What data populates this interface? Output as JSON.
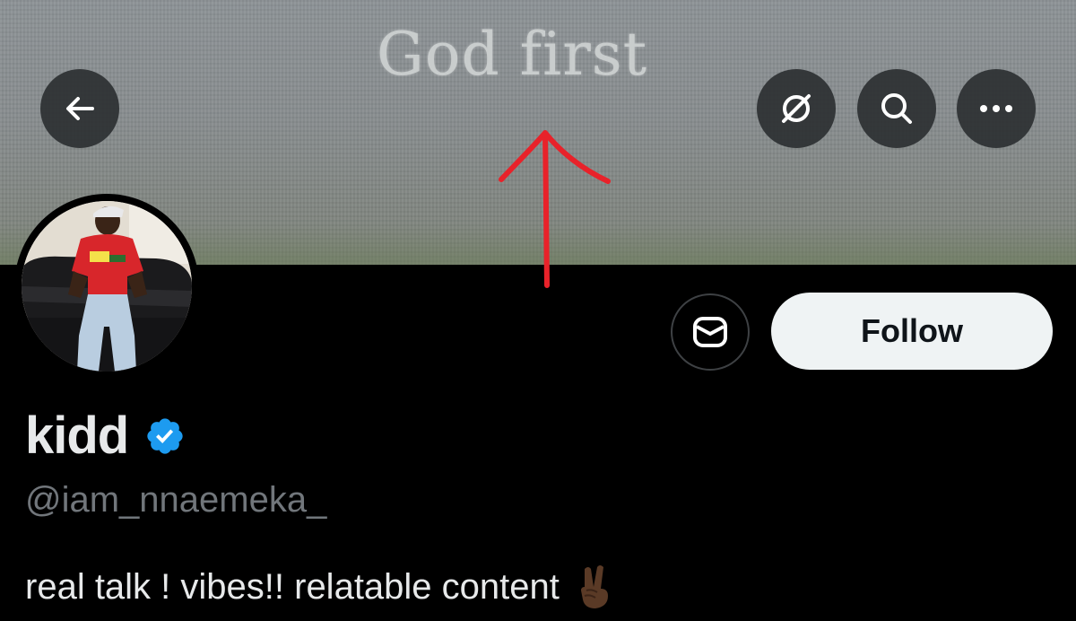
{
  "banner": {
    "text": "God first"
  },
  "header_buttons": {
    "back_icon": "arrow-left-icon",
    "grok_icon": "grok-slash-circle-icon",
    "search_icon": "search-icon",
    "more_icon": "more-horizontal-icon"
  },
  "actions": {
    "message_icon": "envelope-icon",
    "follow_label": "Follow"
  },
  "profile": {
    "display_name": "kidd",
    "verified_badge": "verified-check-icon",
    "handle": "@iam_nnaemeka_",
    "bio": "real talk ! vibes!! relatable content",
    "bio_emoji": "victory-hand-emoji"
  },
  "colors": {
    "background": "#000000",
    "text_primary": "#e7e9ea",
    "text_secondary": "#71767b",
    "verified_blue": "#1d9bf0",
    "follow_bg": "#eff3f4",
    "annotation_red": "#e8222a"
  }
}
